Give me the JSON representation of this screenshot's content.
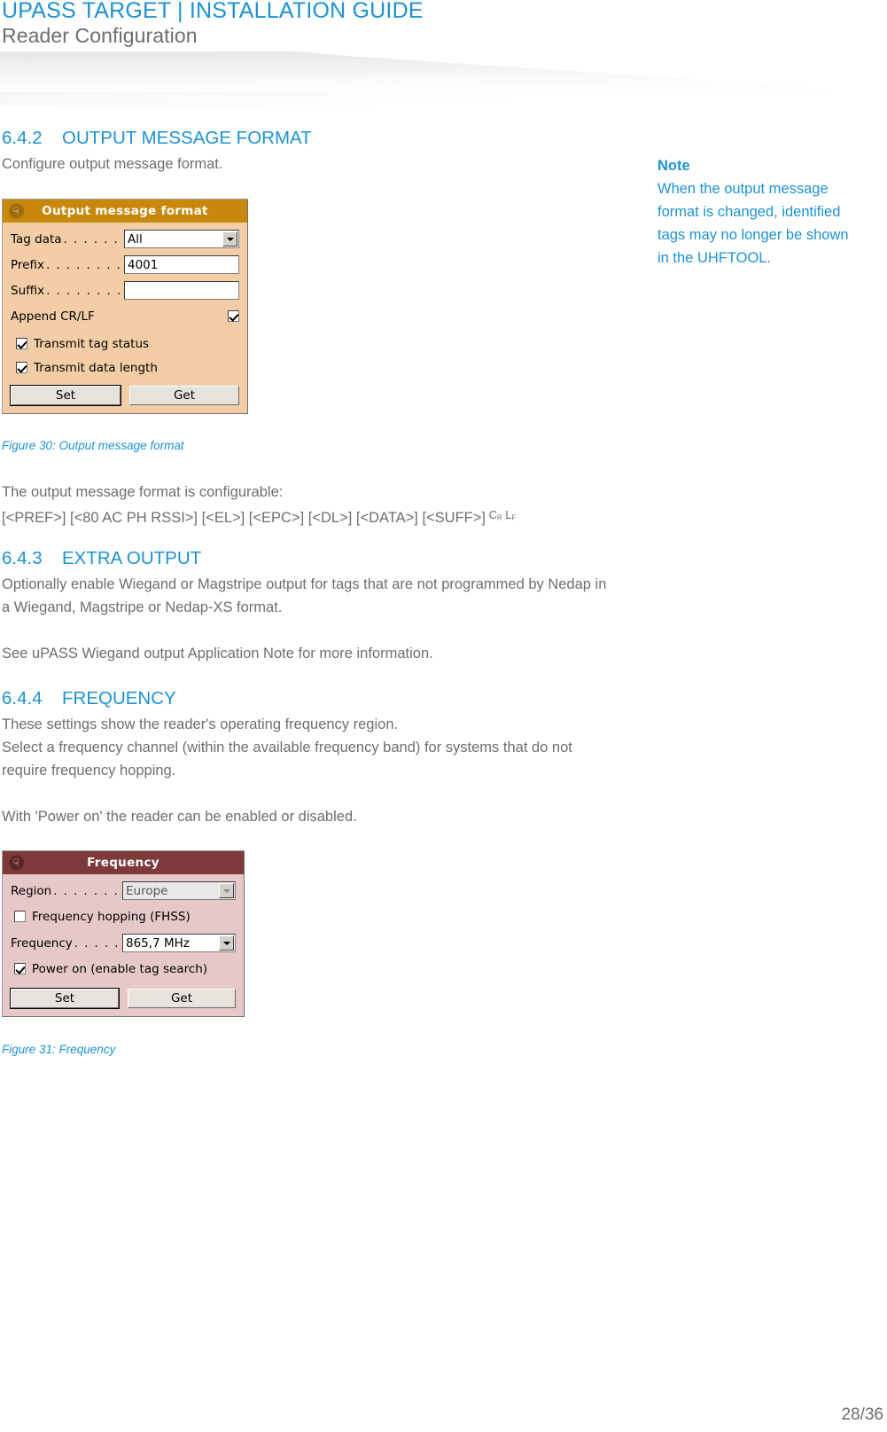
{
  "header": {
    "title": "UPASS TARGET | INSTALLATION GUIDE",
    "subtitle": "Reader Configuration"
  },
  "footer": {
    "page": "28/36"
  },
  "sections": {
    "s642": {
      "number": "6.4.2",
      "title": "OUTPUT MESSAGE FORMAT",
      "intro": "Configure output message format."
    },
    "s643": {
      "number": "6.4.3",
      "title": "EXTRA OUTPUT",
      "para1": "Optionally enable Wiegand or Magstripe output for tags that are not programmed by Nedap in a Wiegand, Magstripe or Nedap-XS format.",
      "para2": "See uPASS Wiegand output Application Note for more information."
    },
    "s644": {
      "number": "6.4.4",
      "title": "FREQUENCY",
      "para1": "These settings show the reader's operating frequency region.",
      "para2": "Select a frequency channel (within the available frequency band) for systems that do not require frequency hopping.",
      "para3": "With 'Power on' the reader can be enabled or disabled."
    }
  },
  "format_note": {
    "lead": "The output message format is configurable:",
    "string": "[<PREF>] [<80 AC PH RSSI>] [<EL>] [<EPC>] [<DL>] [<DATA>] [<SUFF>]",
    "cr": "C",
    "cr_sub": "R",
    "lf": "L",
    "lf_sub": "F"
  },
  "note": {
    "title": "Note",
    "body": "When the output message format is changed, identified tags may no longer be shown in the UHFTOOL."
  },
  "figures": {
    "fig30": "Figure 30: Output message format",
    "fig31": "Figure 31: Frequency"
  },
  "dialog_output": {
    "title": "Output message format",
    "header_color": "#c8880c",
    "body_color": "#f3cda5",
    "chevron_icon": "chevron-double-down-icon",
    "tag_data_label": "Tag data",
    "tag_data_dots": ". . . . . . . . .",
    "tag_data_value": "All",
    "prefix_label": "Prefix",
    "prefix_dots": ". . . . . . . . . . . .",
    "prefix_value": "4001",
    "suffix_label": "Suffix",
    "suffix_dots": ". . . . . . . . . . . .",
    "suffix_value": "",
    "append_crlf_label": "Append CR/LF",
    "append_crlf_checked": true,
    "transmit_tag_status_label": "Transmit tag status",
    "transmit_tag_status_checked": true,
    "transmit_data_length_label": "Transmit data length",
    "transmit_data_length_checked": true,
    "set_label": "Set",
    "get_label": "Get"
  },
  "dialog_frequency": {
    "title": "Frequency",
    "header_color": "#7e3a3a",
    "body_color": "#e7c8c8",
    "chevron_icon": "chevron-double-down-icon",
    "region_label": "Region",
    "region_dots": ". . . . . . . . . . . .",
    "region_value": "Europe",
    "region_disabled": true,
    "fhss_label": "Frequency hopping (FHSS)",
    "fhss_checked": false,
    "frequency_label": "Frequency",
    "frequency_dots": ". . . . . . . . .",
    "frequency_value": "865,7 MHz",
    "power_on_label": "Power on (enable tag search)",
    "power_on_checked": true,
    "set_label": "Set",
    "get_label": "Get"
  }
}
